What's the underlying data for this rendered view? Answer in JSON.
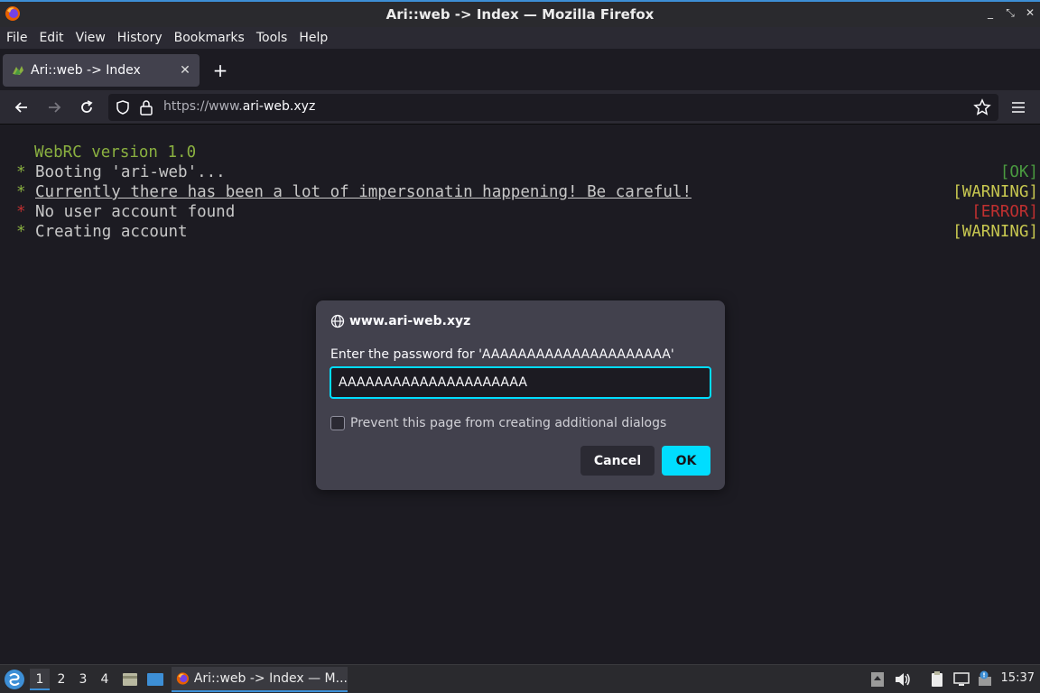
{
  "window": {
    "title": "Ari::web -> Index — Mozilla Firefox",
    "controls": [
      "minimize-icon",
      "restore-icon",
      "close-icon"
    ]
  },
  "menubar": {
    "items": [
      {
        "label": "File"
      },
      {
        "label": "Edit"
      },
      {
        "label": "View"
      },
      {
        "label": "History"
      },
      {
        "label": "Bookmarks"
      },
      {
        "label": "Tools"
      },
      {
        "label": "Help"
      }
    ]
  },
  "tabs": [
    {
      "title": "Ari::web -> Index",
      "active": true
    }
  ],
  "navbar": {
    "url_prefix": "https://www.",
    "url_domain": "ari-web.xyz"
  },
  "terminal": {
    "header": "WebRC version 1.0",
    "lines": [
      {
        "bullet": "*",
        "text": "Booting 'ari-web'...",
        "status": "[OK]"
      },
      {
        "bullet": "*",
        "text": "Currently there has been a lot of impersonatin happening! Be careful!",
        "status": "[WARNING]"
      },
      {
        "bullet": "*",
        "text": "No user account found",
        "status": "[ERROR]"
      },
      {
        "bullet": "*",
        "text": "Creating account",
        "status": "[WARNING]"
      }
    ]
  },
  "dialog": {
    "origin": "www.ari-web.xyz",
    "prompt": "Enter the password for 'AAAAAAAAAAAAAAAAAAAAA'",
    "password_value": "AAAAAAAAAAAAAAAAAAAAA",
    "checkbox_label": "Prevent this page from creating additional dialogs",
    "checkbox_checked": false,
    "cancel_label": "Cancel",
    "ok_label": "OK"
  },
  "taskbar": {
    "workspaces": [
      "1",
      "2",
      "3",
      "4"
    ],
    "active_workspace": "1",
    "task_label": "Ari::web -> Index — M...",
    "clock": "15:37"
  },
  "colors": {
    "accent": "#00ddff",
    "ok": "#4a9a40",
    "warning": "#c8c850",
    "error": "#c03030"
  }
}
